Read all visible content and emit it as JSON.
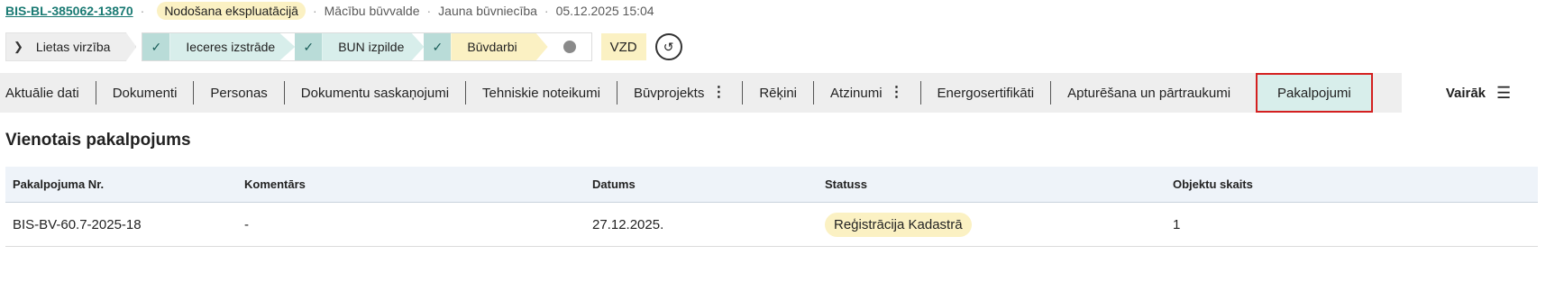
{
  "header": {
    "case_id": "BIS-BL-385062-13870",
    "status": "Nodošana ekspluatācijā",
    "authority": "Mācību būvvalde",
    "type": "Jauna būvniecība",
    "datetime": "05.12.2025 15:04",
    "separator": "·"
  },
  "progress": {
    "lietas_label": "Lietas virzība",
    "steps": [
      {
        "label": "Ieceres izstrāde",
        "state": "done"
      },
      {
        "label": "BUN izpilde",
        "state": "done"
      },
      {
        "label": "Būvdarbi",
        "state": "active"
      }
    ],
    "vzd_label": "VZD",
    "history_icon": "history-icon"
  },
  "tabs": [
    {
      "label": "Aktuālie dati"
    },
    {
      "label": "Dokumenti"
    },
    {
      "label": "Personas"
    },
    {
      "label": "Dokumentu saskaņojumi"
    },
    {
      "label": "Tehniskie noteikumi"
    },
    {
      "label": "Būvprojekts"
    },
    {
      "label": "Rēķini"
    },
    {
      "label": "Atzinumi"
    },
    {
      "label": "Energosertifikāti"
    },
    {
      "label": "Apturēšana un pārtraukumi"
    },
    {
      "label": "Pakalpojumi"
    }
  ],
  "more_label": "Vairāk",
  "section": {
    "title": "Vienotais pakalpojums"
  },
  "table": {
    "headers": [
      "Pakalpojuma Nr.",
      "Komentārs",
      "Datums",
      "Statuss",
      "Objektu skaits"
    ],
    "rows": [
      [
        "BIS-BV-60.7-2025-18",
        "-",
        "27.12.2025.",
        "Reģistrācija Kadastrā",
        "1"
      ]
    ]
  },
  "colors": {
    "accent_teal": "#1a7a73",
    "pill_yellow": "#fbf1c3",
    "step_done": "#d8eeeb",
    "selected_border": "#d42020"
  }
}
